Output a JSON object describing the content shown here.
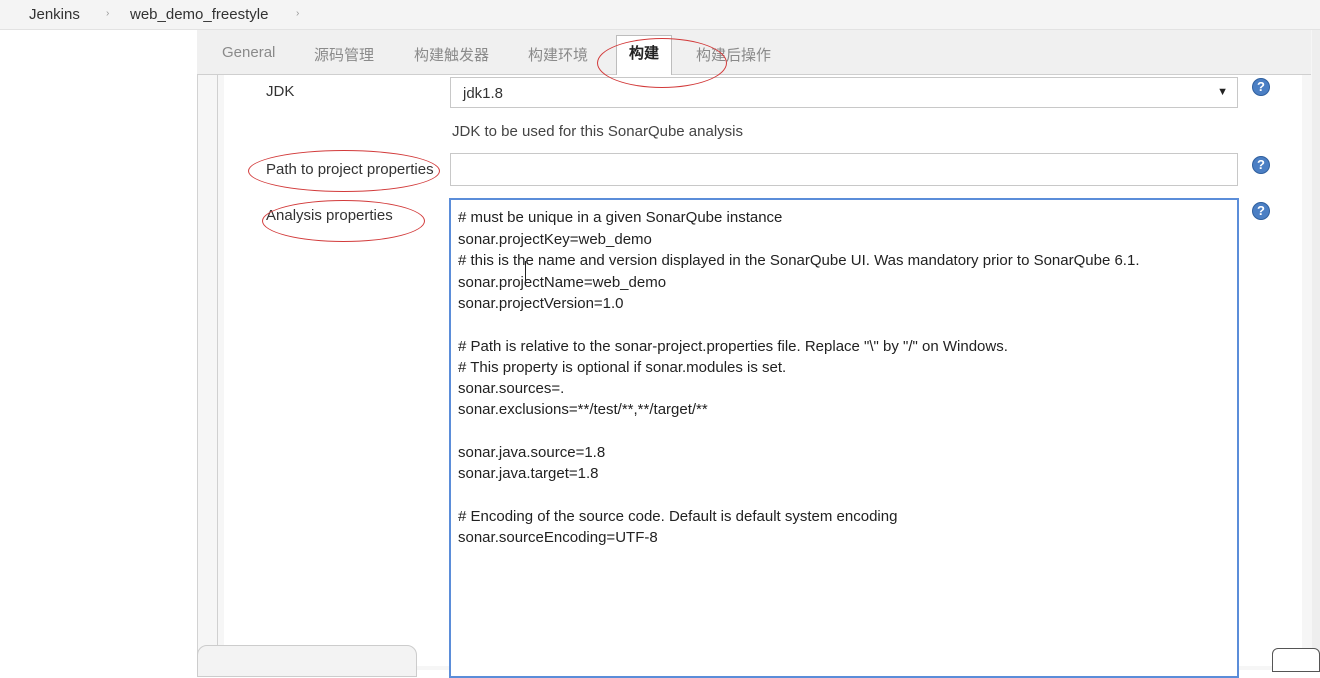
{
  "breadcrumb": {
    "items": [
      "Jenkins",
      "web_demo_freestyle"
    ],
    "separator": "›"
  },
  "tabs": [
    {
      "label": "General"
    },
    {
      "label": "源码管理"
    },
    {
      "label": "构建触发器"
    },
    {
      "label": "构建环境"
    },
    {
      "label": "构建"
    },
    {
      "label": "构建后操作"
    }
  ],
  "form": {
    "jdk_label": "JDK",
    "jdk_value": "jdk1.8",
    "jdk_arrow": "▼",
    "jdk_hint": "JDK to be used for this SonarQube analysis",
    "path_label": "Path to project properties",
    "path_value": "",
    "analysis_label": "Analysis properties",
    "analysis_lines": [
      "# must be unique in a given SonarQube instance",
      "sonar.projectKey=web_demo",
      "# this is the name and version displayed in the SonarQube UI. Was mandatory prior to SonarQube 6.1.",
      "sonar.projectName=web_demo",
      "sonar.projectVersion=1.0",
      "",
      "# Path is relative to the sonar-project.properties file. Replace \"\\\" by \"/\" on Windows.",
      "# This property is optional if sonar.modules is set.",
      "sonar.sources=.",
      "sonar.exclusions=**/test/**,**/target/**",
      "",
      "sonar.java.source=1.8",
      "sonar.java.target=1.8",
      "",
      "# Encoding of the source code. Default is default system encoding",
      "sonar.sourceEncoding=UTF-8"
    ],
    "help": "?"
  },
  "colors": {
    "annotation": "#d23a3a",
    "help_icon": "#4b7fc4",
    "focus_border": "#5b8dd9"
  }
}
